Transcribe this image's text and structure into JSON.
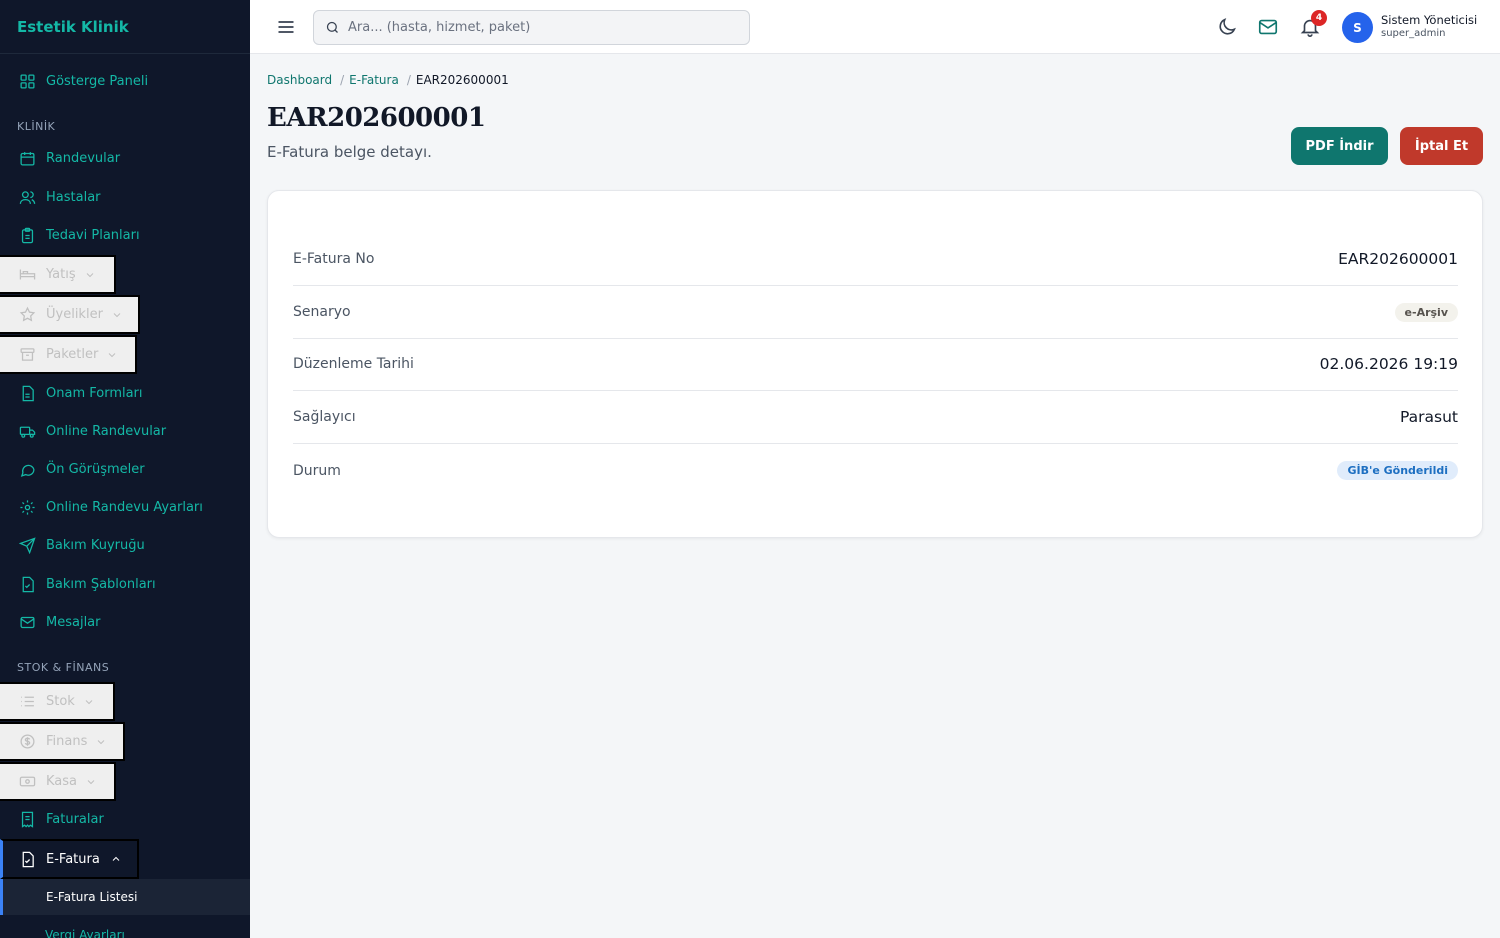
{
  "app": {
    "brand": "Estetik Klinik"
  },
  "sidebar": {
    "dashboard": "Gösterge Paneli",
    "section_klinik": "KLİNİK",
    "randevular": "Randevular",
    "hastalar": "Hastalar",
    "tedavi": "Tedavi Planları",
    "yatis": "Yatış",
    "uyelikler": "Üyelikler",
    "paketler": "Paketler",
    "onam": "Onam Formları",
    "online_randevular": "Online Randevular",
    "on_gorusmeler": "Ön Görüşmeler",
    "online_ayarlar": "Online Randevu Ayarları",
    "bakim_kuyrugu": "Bakım Kuyruğu",
    "bakim_sablonlari": "Bakım Şablonları",
    "mesajlar": "Mesajlar",
    "section_stok": "STOK & FİNANS",
    "stok": "Stok",
    "finans": "Finans",
    "kasa": "Kasa",
    "faturalar": "Faturalar",
    "efatura": "E-Fatura",
    "efatura_listesi": "E-Fatura Listesi",
    "vergi": "Vergi Ayarları"
  },
  "topbar": {
    "search_placeholder": "Ara... (hasta, hizmet, paket)",
    "notification_count": "4",
    "avatar_initial": "S",
    "user_name": "Sistem Yöneticisi",
    "user_role": "super_admin"
  },
  "breadcrumb": {
    "home": "Dashboard",
    "section": "E-Fatura",
    "current": "EAR202600001"
  },
  "page": {
    "title": "EAR202600001",
    "subtitle": "E-Fatura belge detayı.",
    "pdf_button": "PDF İndir",
    "cancel_button": "İptal Et"
  },
  "details": {
    "rows": [
      {
        "label": "E-Fatura No",
        "value": "EAR202600001"
      },
      {
        "label": "Senaryo",
        "value": "e-Arşiv"
      },
      {
        "label": "Düzenleme Tarihi",
        "value": "02.06.2026 19:19"
      },
      {
        "label": "Sağlayıcı",
        "value": "Parasut"
      },
      {
        "label": "Durum",
        "value": "GİB'e Gönderildi"
      }
    ]
  },
  "colors": {
    "sidebar_bg": "#0f172a",
    "accent": "#0f766e",
    "danger": "#c0392b",
    "link": "#14b8a6"
  }
}
